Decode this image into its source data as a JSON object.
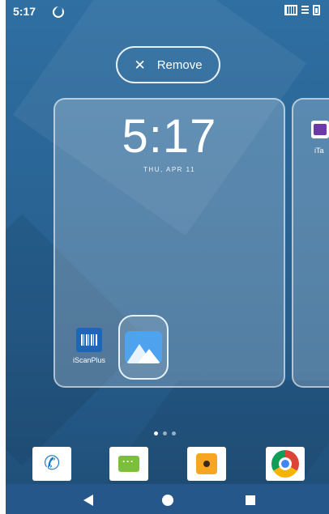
{
  "status_bar": {
    "time": "5:17"
  },
  "remove_action": {
    "label": "Remove",
    "icon": "close-icon"
  },
  "clock_widget": {
    "time": "5:17",
    "date": "THU, APR 11"
  },
  "workspace_apps": [
    {
      "label": "iScanPlus",
      "icon": "barcode-icon"
    },
    {
      "label": "",
      "icon": "gallery-icon"
    }
  ],
  "adjacent_page": {
    "label": "iTa",
    "icon": "itask-icon"
  },
  "page_indicator": {
    "pages": 3,
    "active_index": 0
  },
  "dock": [
    {
      "name": "Phone",
      "icon": "phone-icon"
    },
    {
      "name": "Messaging",
      "icon": "messaging-icon"
    },
    {
      "name": "Music",
      "icon": "music-icon"
    },
    {
      "name": "Chrome",
      "icon": "chrome-icon"
    }
  ],
  "nav_bar": {
    "buttons": [
      "back",
      "home",
      "recents"
    ]
  },
  "colors": {
    "wallpaper": "#2a6596",
    "accent": "#1a78d4"
  }
}
